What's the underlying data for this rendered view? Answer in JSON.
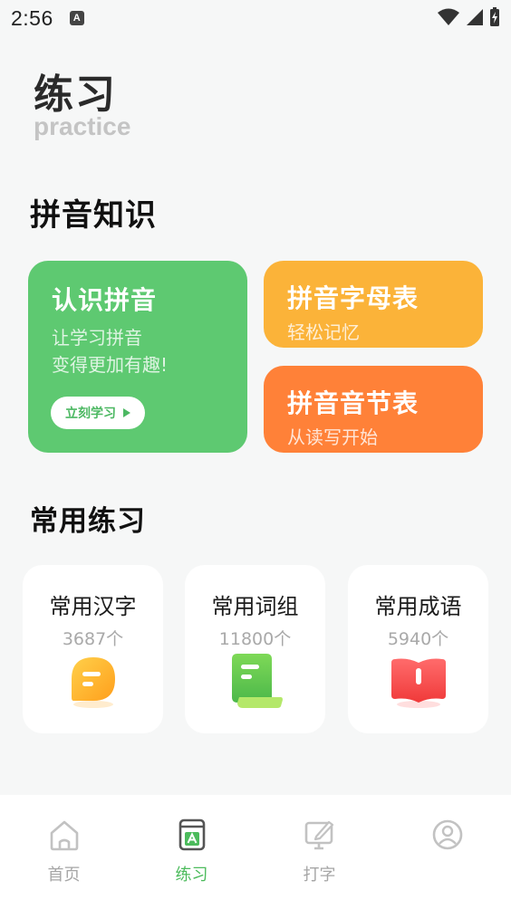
{
  "status_bar": {
    "time": "2:56",
    "notification_icon": "A"
  },
  "header": {
    "title": "练习",
    "subtitle": "practice"
  },
  "sections": {
    "pinyin_title": "拼音知识",
    "common_title": "常用练习"
  },
  "pinyin_cards": [
    {
      "title": "认识拼音",
      "desc_line1": "让学习拼音",
      "desc_line2": "变得更加有趣!",
      "button_label": "立刻学习",
      "color": "#5ec971"
    },
    {
      "title": "拼音字母表",
      "desc": "轻松记忆",
      "color": "#fbb339"
    },
    {
      "title": "拼音音节表",
      "desc": "从读写开始",
      "color": "#ff8138"
    }
  ],
  "practice_cards": [
    {
      "title": "常用汉字",
      "count": "3687个",
      "icon": "chat-bubble-icon"
    },
    {
      "title": "常用词组",
      "count": "11800个",
      "icon": "scroll-icon"
    },
    {
      "title": "常用成语",
      "count": "5940个",
      "icon": "open-book-icon"
    }
  ],
  "tabbar": {
    "tabs": [
      {
        "label": "首页",
        "icon": "home-icon",
        "active": false
      },
      {
        "label": "练习",
        "icon": "practice-book-icon",
        "active": true
      },
      {
        "label": "打字",
        "icon": "typing-monitor-icon",
        "active": false
      },
      {
        "label": "",
        "icon": "profile-icon",
        "active": false
      }
    ],
    "active_color": "#4cbb5c"
  }
}
